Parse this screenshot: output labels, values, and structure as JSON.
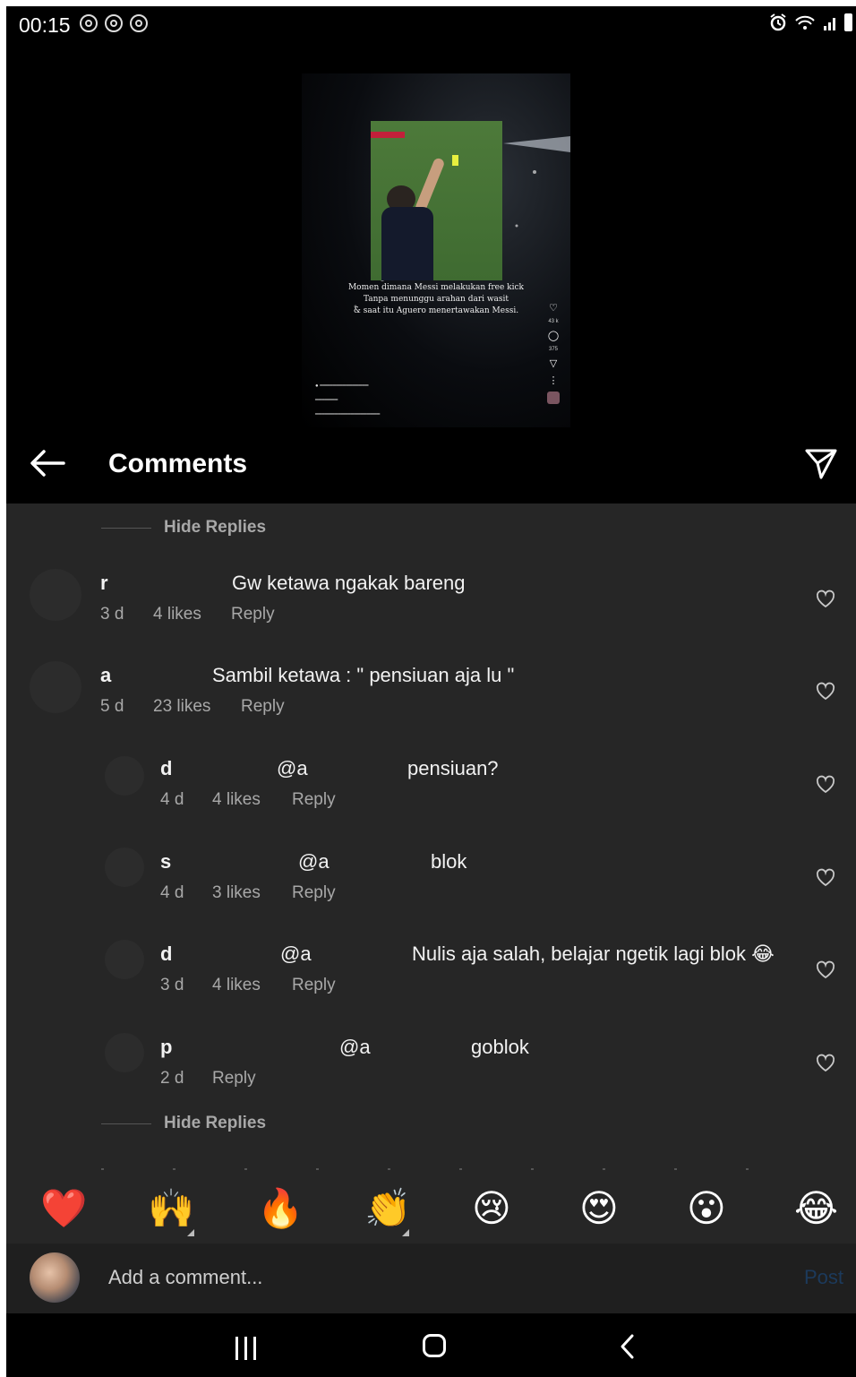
{
  "status_bar": {
    "time": "00:15",
    "notification_icons": [
      "notification-icon",
      "notification-icon",
      "notification-icon"
    ],
    "right_icons": [
      "alarm-icon",
      "wifi-icon",
      "signal-icon",
      "battery-icon"
    ]
  },
  "video": {
    "caption_lines": [
      "Momen dimana Messi melakukan free kick",
      "Tanpa menunggu arahan dari wasit",
      "& saat itu Aguero menertawakan Messi."
    ],
    "like_count": "43 k",
    "comment_count": "375"
  },
  "header": {
    "title": "Comments",
    "back_icon": "arrow-left-icon",
    "share_icon": "paper-plane-icon"
  },
  "colors": {
    "panel_bg": "#262626",
    "header_bg": "#000000",
    "text_primary": "#f2f2f2",
    "text_secondary": "#a8a8a8",
    "post_disabled": "#1c3a5c"
  },
  "comments": {
    "hide_replies_top": "Hide Replies",
    "hide_replies_bottom": "Hide Replies",
    "items": [
      {
        "username": "r",
        "text": "Gw ketawa ngakak bareng",
        "time": "3 d",
        "likes": "4 likes",
        "reply": "Reply"
      },
      {
        "username": "a",
        "text": "Sambil ketawa : \" pensiuan aja lu \"",
        "time": "5 d",
        "likes": "23 likes",
        "reply": "Reply"
      }
    ],
    "replies": [
      {
        "username": "d",
        "mention": "@a",
        "text": "pensiuan?",
        "time": "4 d",
        "likes": "4 likes",
        "reply": "Reply"
      },
      {
        "username": "s",
        "mention": "@a",
        "text": "blok",
        "time": "4 d",
        "likes": "3 likes",
        "reply": "Reply"
      },
      {
        "username": "d",
        "mention": "@a",
        "text": "Nulis aja salah, belajar ngetik lagi blok 😂",
        "time": "3 d",
        "likes": "4 likes",
        "reply": "Reply"
      },
      {
        "username": "p",
        "mention": "@a",
        "text": "goblok",
        "time": "2 d",
        "reply": "Reply"
      }
    ]
  },
  "reactions": [
    "❤️",
    "🙌",
    "🔥",
    "👏",
    "😢",
    "😍",
    "😮",
    "😂"
  ],
  "composer": {
    "placeholder": "Add a comment...",
    "post_label": "Post"
  }
}
